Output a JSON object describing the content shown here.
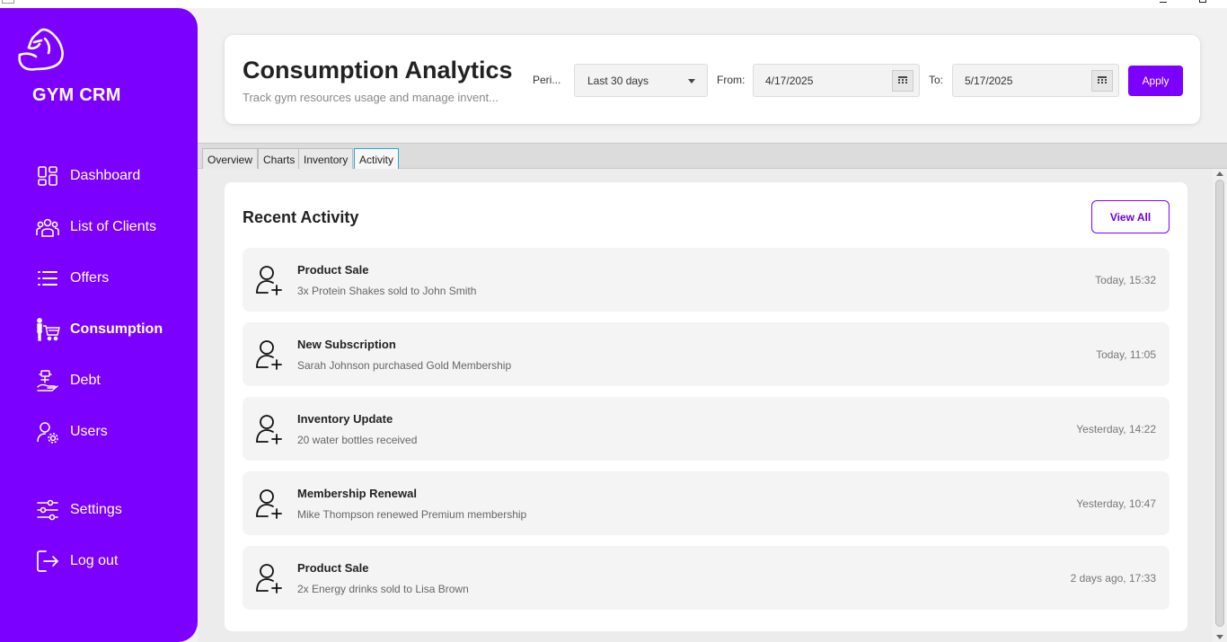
{
  "app": {
    "brand": "GYM CRM",
    "accent": "#7c00ff"
  },
  "sidebar": {
    "items": [
      {
        "label": "Dashboard",
        "icon": "dashboard-icon"
      },
      {
        "label": "List of Clients",
        "icon": "clients-icon"
      },
      {
        "label": "Offers",
        "icon": "list-icon"
      },
      {
        "label": "Consumption",
        "icon": "cart-icon",
        "active": true
      },
      {
        "label": "Debt",
        "icon": "debt-icon"
      },
      {
        "label": "Users",
        "icon": "user-gear-icon"
      },
      {
        "label": "Settings",
        "icon": "sliders-icon"
      },
      {
        "label": "Log out",
        "icon": "logout-icon"
      }
    ]
  },
  "header": {
    "title": "Consumption Analytics",
    "subtitle": "Track gym resources usage and manage invent...",
    "period_label": "Peri...",
    "period_value": "Last 30 days",
    "from_label": "From:",
    "from_value": "4/17/2025",
    "to_label": "To:",
    "to_value": "5/17/2025",
    "apply_label": "Apply"
  },
  "tabs": [
    {
      "label": "Overview"
    },
    {
      "label": "Charts"
    },
    {
      "label": "Inventory"
    },
    {
      "label": "Activity",
      "active": true
    }
  ],
  "activity": {
    "title": "Recent Activity",
    "view_all_label": "View All",
    "items": [
      {
        "title": "Product Sale",
        "desc": "3x Protein Shakes sold to John Smith",
        "time": "Today, 15:32",
        "icon": "user-add-icon"
      },
      {
        "title": "New Subscription",
        "desc": "Sarah Johnson purchased Gold Membership",
        "time": "Today, 11:05",
        "icon": "user-add-icon"
      },
      {
        "title": "Inventory Update",
        "desc": "20 water bottles received",
        "time": "Yesterday, 14:22",
        "icon": "user-add-icon"
      },
      {
        "title": "Membership Renewal",
        "desc": "Mike Thompson renewed Premium membership",
        "time": "Yesterday, 10:47",
        "icon": "user-add-icon"
      },
      {
        "title": "Product Sale",
        "desc": "2x Energy drinks sold to Lisa Brown",
        "time": "2 days ago, 17:33",
        "icon": "user-add-icon"
      }
    ]
  }
}
